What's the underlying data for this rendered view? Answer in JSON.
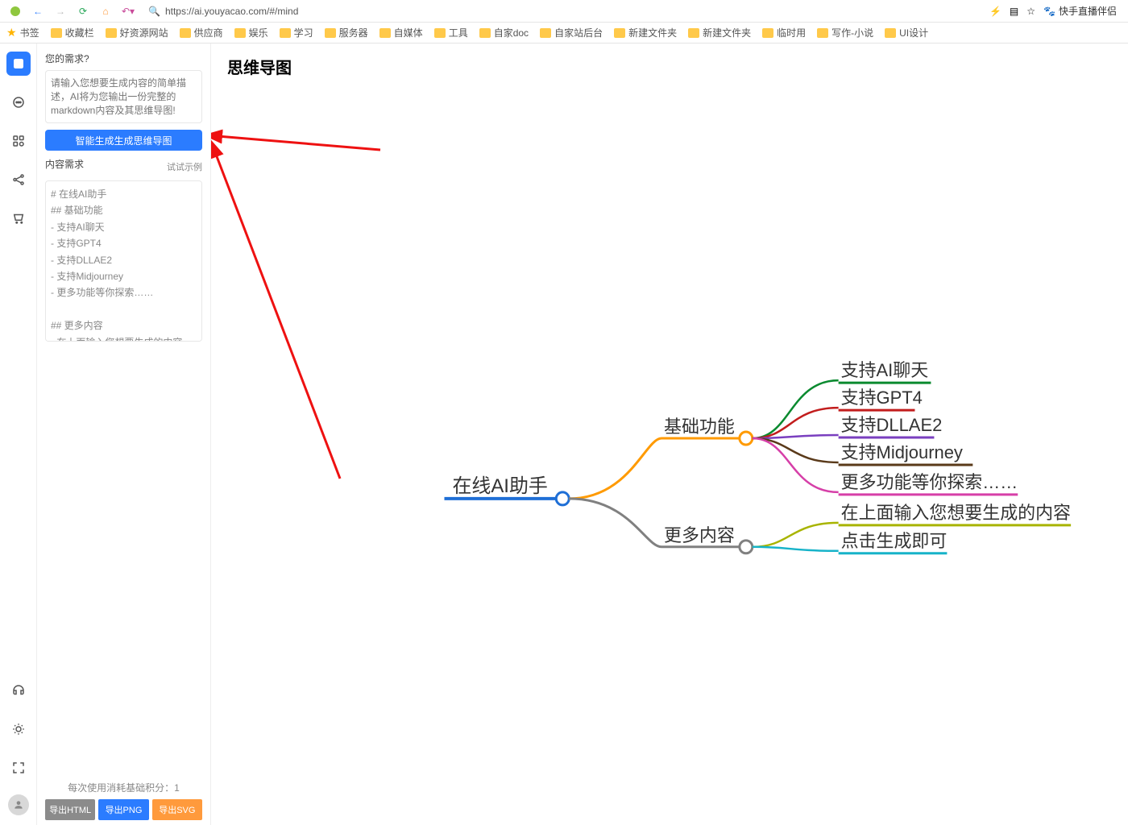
{
  "browser": {
    "url": "https://ai.youyacao.com/#/mind",
    "extension_label": "快手直播伴侣"
  },
  "bookmarks": [
    {
      "label": "书签",
      "type": "star"
    },
    {
      "label": "收藏栏",
      "type": "folder"
    },
    {
      "label": "好资源网站",
      "type": "folder"
    },
    {
      "label": "供应商",
      "type": "folder"
    },
    {
      "label": "娱乐",
      "type": "folder"
    },
    {
      "label": "学习",
      "type": "folder"
    },
    {
      "label": "服务器",
      "type": "folder"
    },
    {
      "label": "自媒体",
      "type": "folder"
    },
    {
      "label": "工具",
      "type": "folder"
    },
    {
      "label": "自家doc",
      "type": "folder"
    },
    {
      "label": "自家站后台",
      "type": "folder"
    },
    {
      "label": "新建文件夹",
      "type": "folder"
    },
    {
      "label": "新建文件夹",
      "type": "folder"
    },
    {
      "label": "临时用",
      "type": "folder"
    },
    {
      "label": "写作-小说",
      "type": "folder"
    },
    {
      "label": "UI设计",
      "type": "folder"
    }
  ],
  "sidebar": {
    "q_label": "您的需求?",
    "q_placeholder": "请输入您想要生成内容的简单描述，AI将为您输出一份完整的markdown内容及其思维导图!",
    "generate_btn": "智能生成生成思维导图",
    "content_label": "内容需求",
    "example_link": "试试示例",
    "content_value": "# 在线AI助手\n## 基础功能\n- 支持AI聊天\n- 支持GPT4\n- 支持DLLAE2\n- 支持Midjourney\n- 更多功能等你探索……\n\n## 更多内容\n- 在上面输入您想要生成的内容\n- 点击生成即可",
    "credits_text": "每次使用消耗基础积分：",
    "credits_value": "1",
    "export_html": "导出HTML",
    "export_png": "导出PNG",
    "export_svg": "导出SVG"
  },
  "main": {
    "title": "思维导图"
  },
  "mindmap": {
    "root": "在线AI助手",
    "branches": [
      {
        "label": "基础功能",
        "color": "#ff9a00",
        "children": [
          {
            "label": "支持AI聊天",
            "color": "#0a8a2f"
          },
          {
            "label": "支持GPT4",
            "color": "#c21d1d"
          },
          {
            "label": "支持DLLAE2",
            "color": "#7a3fbf"
          },
          {
            "label": "支持Midjourney",
            "color": "#5a3a1a"
          },
          {
            "label": "更多功能等你探索……",
            "color": "#d63fa8"
          }
        ]
      },
      {
        "label": "更多内容",
        "color": "#808080",
        "children": [
          {
            "label": "在上面输入您想要生成的内容",
            "color": "#a8b400"
          },
          {
            "label": "点击生成即可",
            "color": "#17b3c9"
          }
        ]
      }
    ]
  }
}
